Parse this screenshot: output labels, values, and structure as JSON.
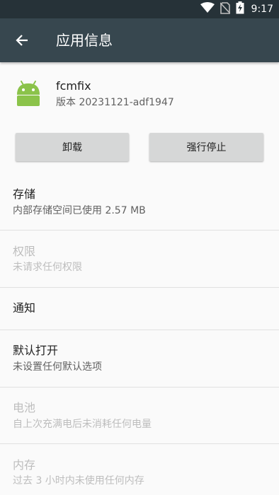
{
  "status_bar": {
    "time": "9:17"
  },
  "app_bar": {
    "title": "应用信息"
  },
  "app": {
    "name": "fcmfix",
    "version": "版本 20231121-adf1947"
  },
  "buttons": {
    "uninstall": "卸载",
    "force_stop": "强行停止"
  },
  "prefs": [
    {
      "title": "存储",
      "summary": "内部存储空间已使用 2.57 MB",
      "enabled": true
    },
    {
      "title": "权限",
      "summary": "未请求任何权限",
      "enabled": false
    },
    {
      "title": "通知",
      "summary": "",
      "enabled": true
    },
    {
      "title": "默认打开",
      "summary": "未设置任何默认选项",
      "enabled": true
    },
    {
      "title": "电池",
      "summary": "自上次充满电后未消耗任何电量",
      "enabled": false
    },
    {
      "title": "内存",
      "summary": "过去 3 小时内未使用任何内存",
      "enabled": false
    }
  ],
  "colors": {
    "status_bar": "#263238",
    "app_bar": "#37474f",
    "android_green": "#8bc34a"
  }
}
